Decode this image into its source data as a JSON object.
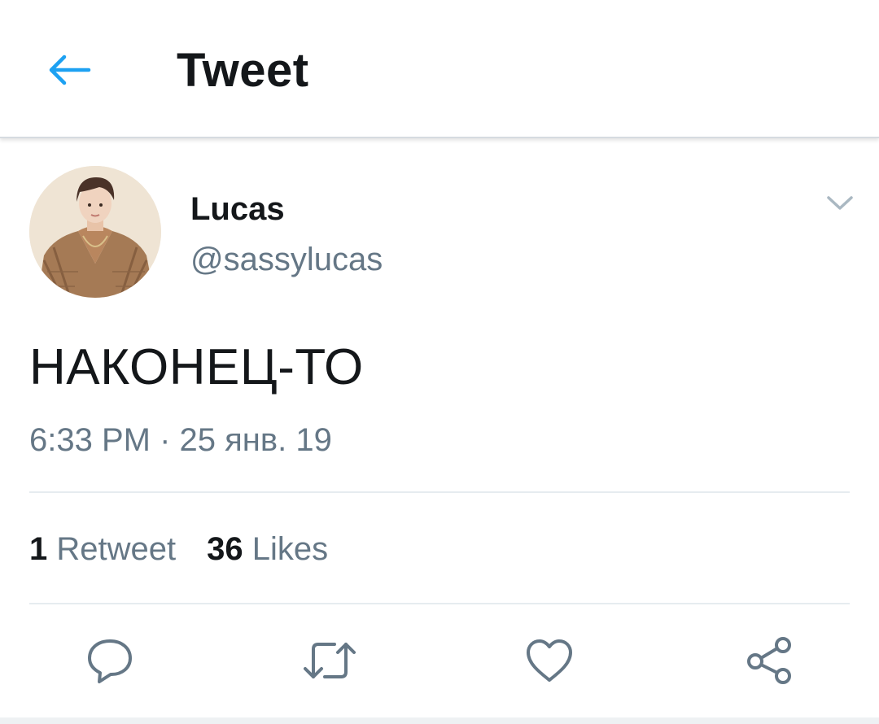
{
  "header": {
    "back_icon": "arrow-left-icon",
    "title": "Tweet"
  },
  "colors": {
    "accent": "#1da1f2",
    "text_primary": "#14171a",
    "text_secondary": "#657786",
    "divider": "#e6ecf0"
  },
  "tweet": {
    "author": {
      "name": "Lucas",
      "handle": "@sassylucas",
      "avatar_icon": "profile-photo"
    },
    "menu_icon": "chevron-down-icon",
    "text": "НАКОНЕЦ-ТО",
    "timestamp": "6:33 PM · 25 янв. 19",
    "stats": {
      "retweets_count": "1",
      "retweets_label": "Retweet",
      "likes_count": "36",
      "likes_label": "Likes"
    }
  },
  "actions": [
    {
      "icon": "reply-icon"
    },
    {
      "icon": "retweet-icon"
    },
    {
      "icon": "like-icon"
    },
    {
      "icon": "share-icon"
    }
  ]
}
